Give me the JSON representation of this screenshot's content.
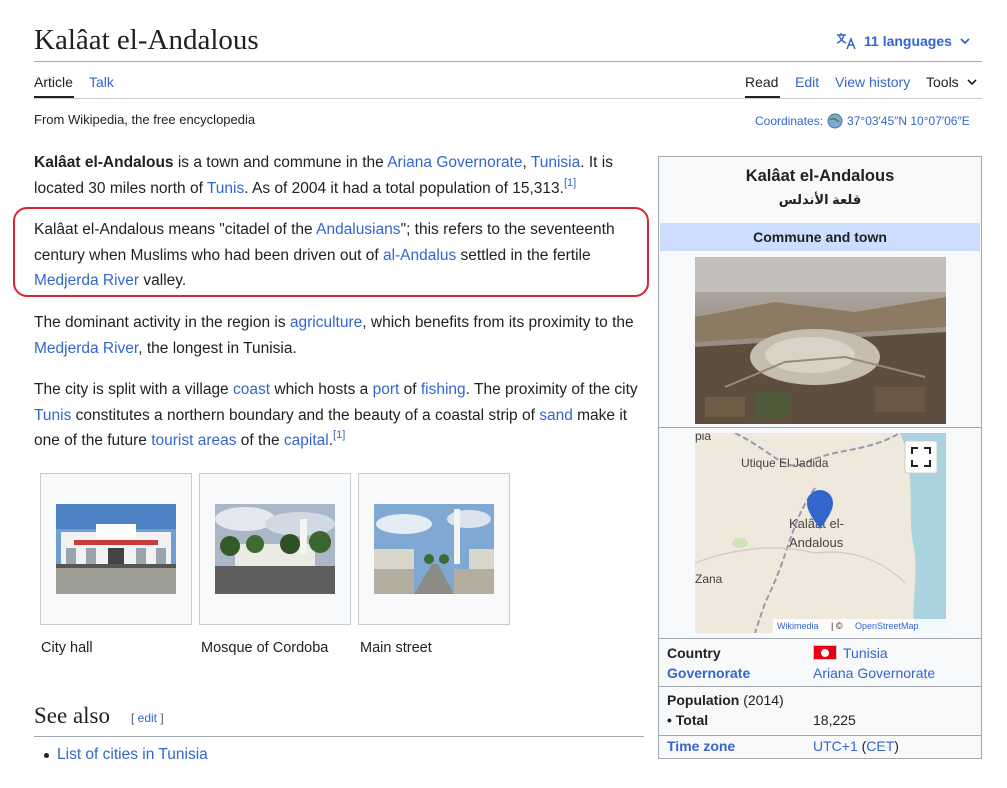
{
  "page": {
    "title": "Kalâat el-Andalous",
    "languages": "11 languages",
    "tagline": "From Wikipedia, the free encyclopedia"
  },
  "tabs": {
    "article": "Article",
    "talk": "Talk",
    "read": "Read",
    "edit": "Edit",
    "history": "View history",
    "tools": "Tools"
  },
  "coordinates": {
    "label": "Coordinates:",
    "value": "37°03′45″N 10°07′06″E"
  },
  "body": {
    "p1": {
      "bold": "Kalâat el-Andalous",
      "t1": " is a town and commune in the ",
      "l1": "Ariana Governorate",
      "t2": ", ",
      "l2": "Tunisia",
      "t3": ". It is located 30 miles north of ",
      "l3": "Tunis",
      "t4": ". As of 2004 it had a total population of 15,313.",
      "ref": "[1]"
    },
    "p2": {
      "t1": "Kalâat el-Andalous means \"citadel of the ",
      "l1": "Andalusians",
      "t2": "\"; this refers to the seventeenth century when Muslims who had been driven out of ",
      "l2": "al-Andalus",
      "t3": " settled in the fertile ",
      "l3": "Medjerda River",
      "t4": " valley."
    },
    "p3": {
      "t1": "The dominant activity in the region is ",
      "l1": "agriculture",
      "t2": ", which benefits from its proximity to the ",
      "l2": "Medjerda River",
      "t3": ", the longest in Tunisia."
    },
    "p4": {
      "t1": "The city is split with a village ",
      "l1": "coast",
      "t2": " which hosts a ",
      "l2": "port",
      "t3": " of ",
      "l3": "fishing",
      "t4": ". The proximity of the city ",
      "l4": "Tunis",
      "t5": " constitutes a northern boundary and the beauty of a coastal strip of ",
      "l5": "sand",
      "t6": " make it one of the future ",
      "l6": "tourist areas",
      "t7": " of the ",
      "l7": "capital",
      "t8": ".",
      "ref": "[1]"
    }
  },
  "gallery": [
    {
      "caption": "City hall"
    },
    {
      "caption": "Mosque of Cordoba"
    },
    {
      "caption": "Main street"
    }
  ],
  "see_also": {
    "heading": "See also",
    "edit": "[ edit ]",
    "item": "List of cities in Tunisia"
  },
  "infobox": {
    "title": "Kalâat el-Andalous",
    "native": "قلعة الأندلس",
    "type": "Commune and town",
    "map": {
      "label_town": "Kalâat el-Andalous",
      "label_utique": "Utique El Jadida",
      "label_zana": "Zana",
      "label_pia": "pia",
      "attribution_wikimedia": "Wikimedia",
      "attribution_sep": " | © ",
      "attribution_osm": "OpenStreetMap"
    },
    "rows": {
      "country_label": "Country",
      "country_value": "Tunisia",
      "gov_label": "Governorate",
      "gov_value": "Ariana Governorate",
      "pop_label": "Population",
      "pop_year": " (2014)",
      "total_label": " • Total",
      "total_value": "18,225",
      "tz_label": "Time zone",
      "tz_value": "UTC+1",
      "tz_open": " (",
      "tz_abbr": "CET",
      "tz_close": ")"
    }
  },
  "colors": {
    "link": "#3366cc",
    "highlight": "#d6262f",
    "infobox_header": "#ccddff"
  }
}
